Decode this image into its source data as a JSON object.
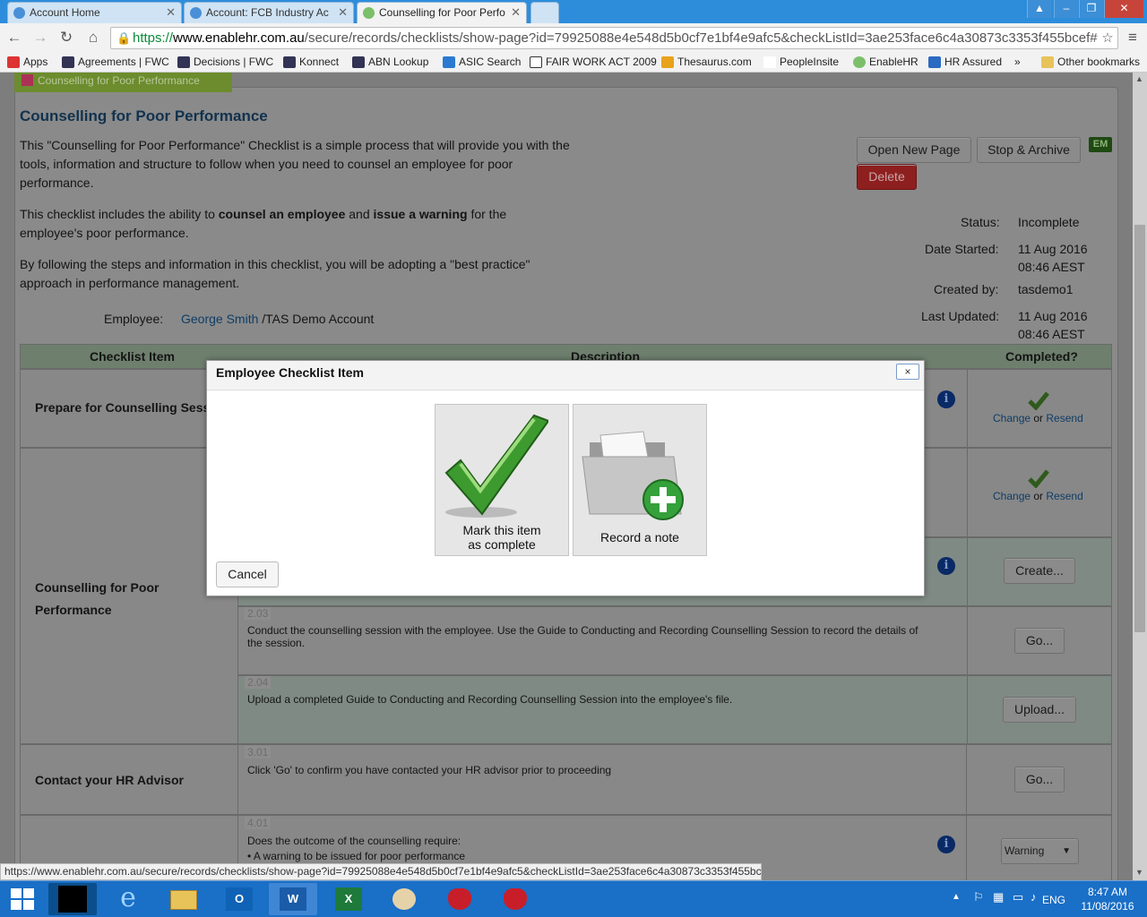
{
  "browser": {
    "tabs": [
      {
        "title": "Account Home"
      },
      {
        "title": "Account: FCB Industry Ac"
      },
      {
        "title": "Counselling for Poor Perfo"
      }
    ],
    "url_scheme": "https://",
    "url_host": "www.enablehr.com.au",
    "url_path": "/secure/records/checklists/show-page?id=79925088e4e548d5b0cf7e1bf4e9afc5&checkListId=3ae253face6c4a30873c3353f455bcef#",
    "bookmarks": [
      "Apps",
      "Agreements | FWC",
      "Decisions | FWC",
      "Konnect",
      "ABN Lookup",
      "ASIC Search",
      "FAIR WORK ACT 2009",
      "Thesaurus.com",
      "PeopleInsite",
      "EnableHR",
      "HR Assured",
      "»",
      "Other bookmarks"
    ],
    "status_url": "https://www.enablehr.com.au/secure/records/checklists/show-page?id=79925088e4e548d5b0cf7e1bf4e9afc5&checkListId=3ae253face6c4a30873c3353f455bcef#"
  },
  "page": {
    "top_tab": "Counselling for Poor Performance",
    "title": "Counselling for Poor Performance",
    "intro_1": "This \"Counselling for Poor Performance\" Checklist is a simple process that will provide you with the",
    "intro_2": "tools, information and structure to follow when you need to counsel an employee for poor",
    "intro_3": "performance.",
    "includes_pre": "This checklist includes the ability to ",
    "includes_b1": "counsel an employee",
    "includes_mid": " and ",
    "includes_b2": "issue a warning",
    "includes_post": " for the",
    "includes_2": "employee's poor performance.",
    "following_1": "By following the steps and information in this checklist, you will be adopting a \"best practice\"",
    "following_2": "approach in performance management.",
    "employee_label": "Employee:",
    "employee_name": "George Smith",
    "employee_account": " /TAS Demo Account",
    "buttons": {
      "open_new_page": "Open New Page",
      "stop_archive": "Stop & Archive",
      "delete": "Delete",
      "em": "EM"
    },
    "meta": {
      "status_label": "Status:",
      "status_value": "Incomplete",
      "started_label": "Date Started:",
      "started_value_1": "11 Aug 2016",
      "started_value_2": "08:46 AEST",
      "created_label": "Created by:",
      "created_value": "tasdemo1",
      "updated_label": "Last Updated:",
      "updated_value_1": "11 Aug 2016",
      "updated_value_2": "08:46 AEST"
    },
    "grid": {
      "col_item": "Checklist Item",
      "col_desc": "Description",
      "col_completed": "Completed?",
      "sections": {
        "prepare": "Prepare for Counselling Sessio",
        "counselling_1": "Counselling for Poor",
        "counselling_2": "Performance",
        "contact": "Contact your HR Advisor"
      },
      "change": "Change",
      "or": " or ",
      "resend": "Resend",
      "create": "Create...",
      "go": "Go...",
      "upload": "Upload...",
      "warning_select": "Warning",
      "rows": {
        "r203_num": "2.03",
        "r203_desc_1": "Conduct the counselling session with the employee. Use the Guide to Conducting and Recording Counselling Session to record the details of",
        "r203_desc_2": "the session.",
        "r204_num": "2.04",
        "r204_desc": "Upload a completed Guide to Conducting and Recording Counselling Session into the employee's file.",
        "r301_num": "3.01",
        "r301_desc": "Click 'Go' to confirm you have contacted your HR advisor prior to proceeding",
        "r401_num": "4.01",
        "r401_desc_1": "Does the outcome of the counselling require:",
        "r401_desc_2": "A warning to be issued for poor performance"
      }
    }
  },
  "modal": {
    "title": "Employee Checklist Item",
    "close": "×",
    "mark_complete_1": "Mark this item",
    "mark_complete_2": "as complete",
    "record_note": "Record a note",
    "cancel": "Cancel"
  },
  "taskbar": {
    "lang": "ENG",
    "time": "8:47 AM",
    "date": "11/08/2016"
  }
}
